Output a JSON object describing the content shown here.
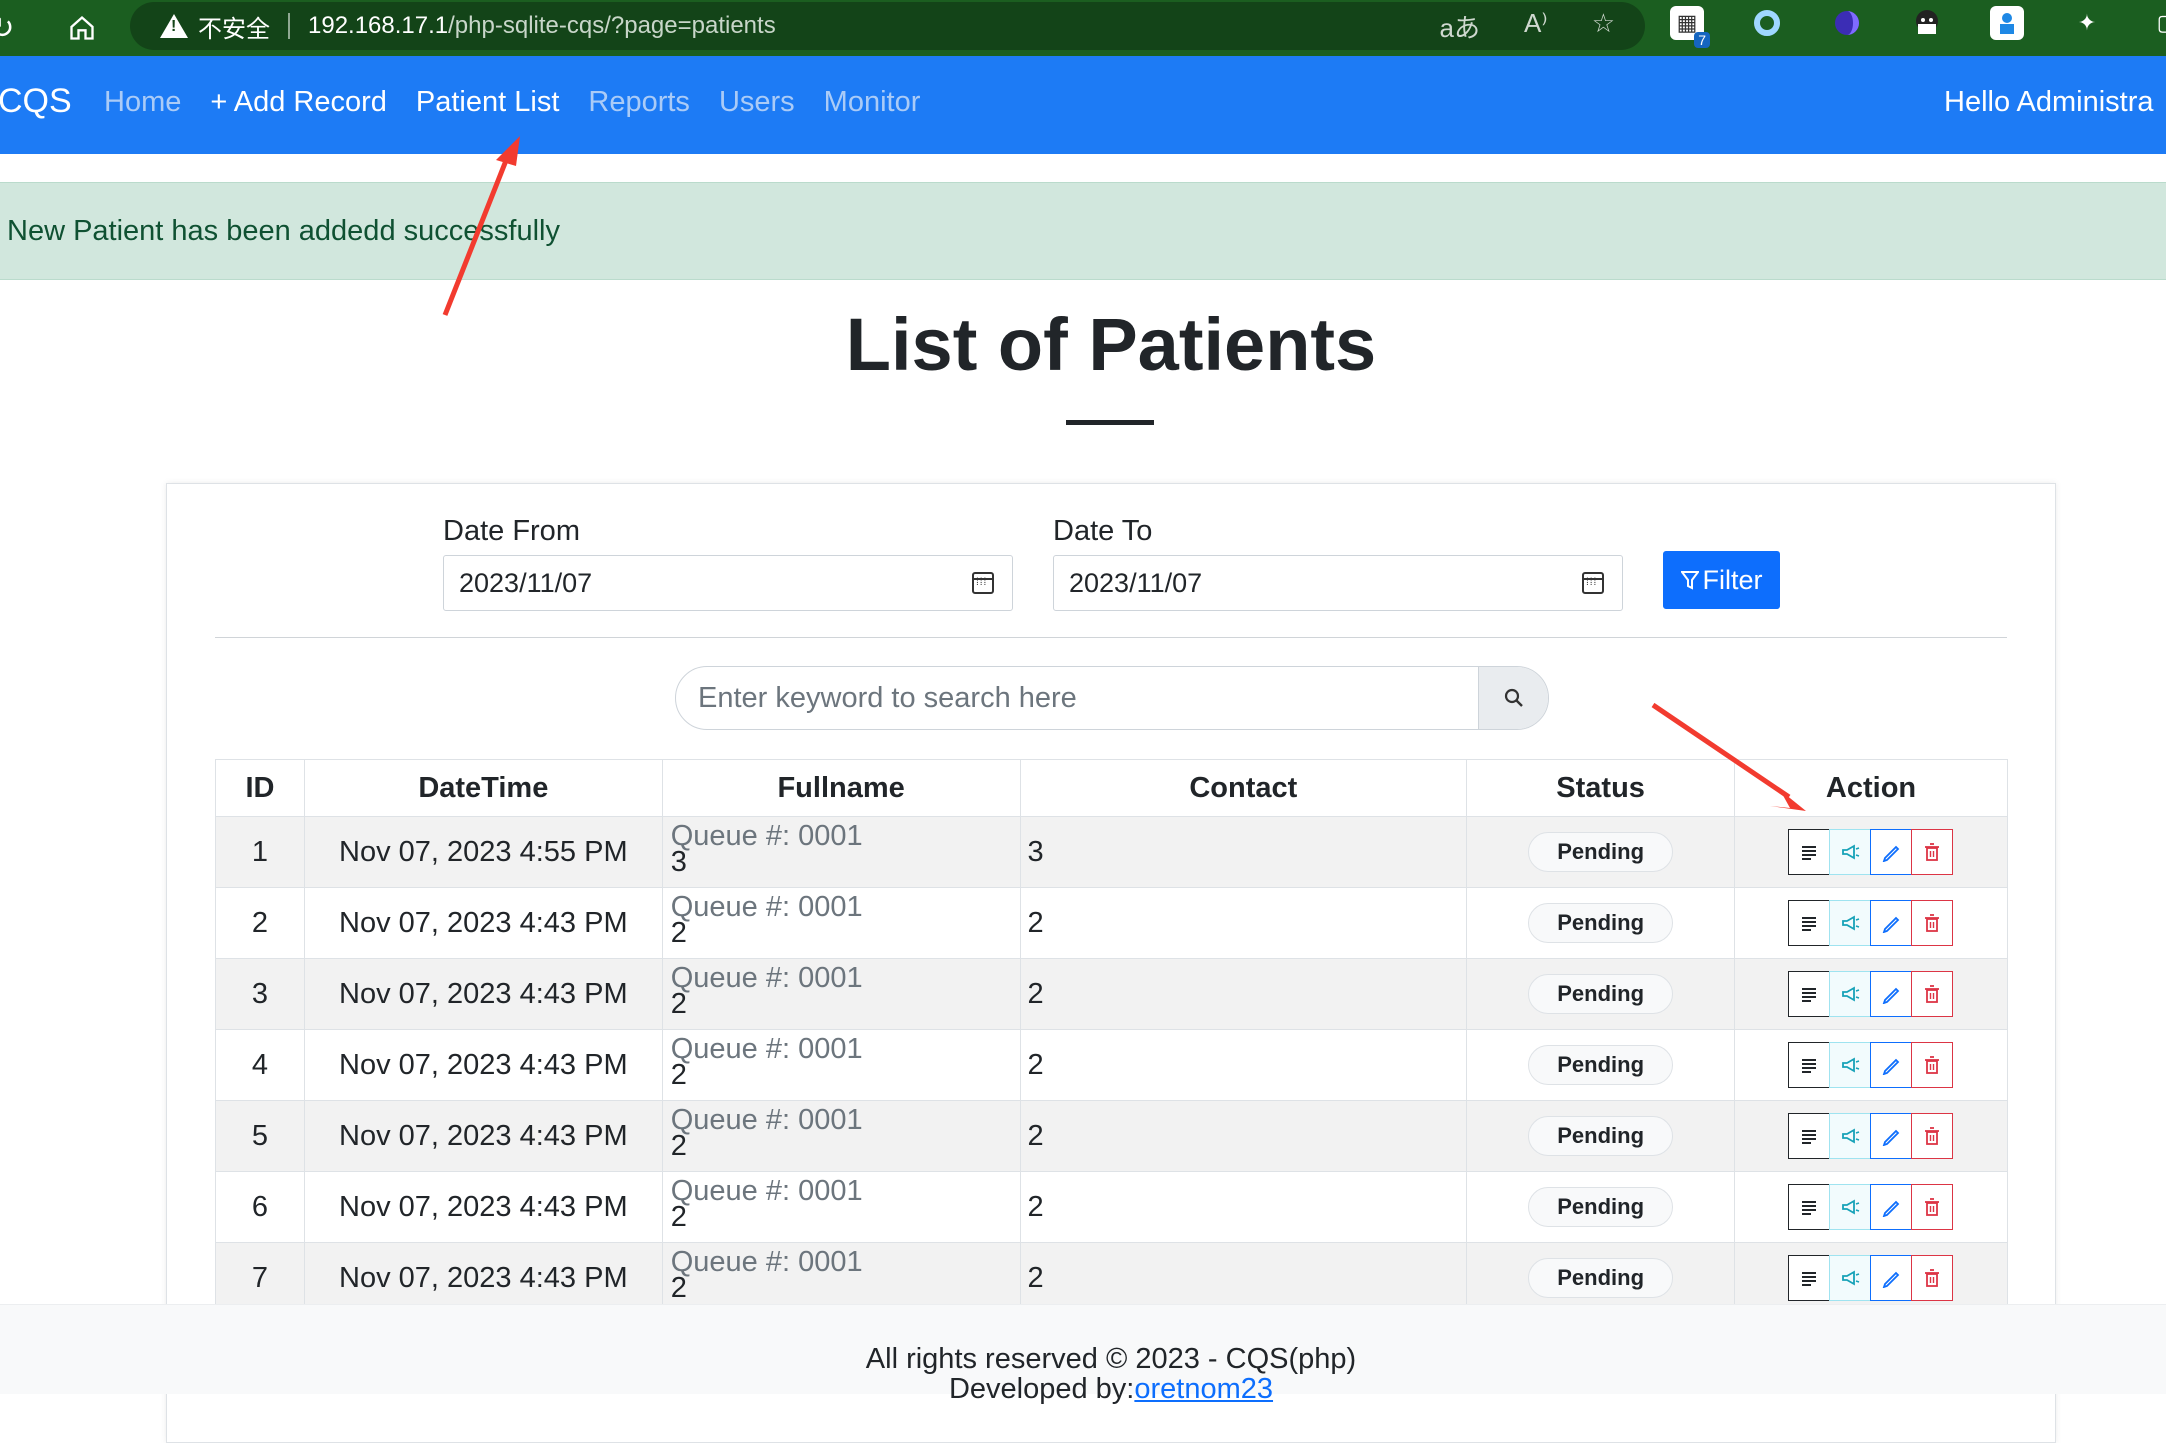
{
  "browser": {
    "security_text": "不安全",
    "url_host": "192.168.17.1",
    "url_path": "/php-sqlite-cqs/?page=patients",
    "extension_badge": "7",
    "colors": {
      "chrome": "#1b5e20",
      "address_bar": "#134418"
    }
  },
  "navbar": {
    "brand": "CQS",
    "links": [
      {
        "label": "Home",
        "active": false
      },
      {
        "label": "+ Add Record",
        "active": true
      },
      {
        "label": "Patient List",
        "active": true
      },
      {
        "label": "Reports",
        "active": false
      },
      {
        "label": "Users",
        "active": false
      },
      {
        "label": "Monitor",
        "active": false
      }
    ],
    "greeting": "Hello Administra",
    "color": "#1d7bf5"
  },
  "alert": {
    "message": "New Patient has been addedd successfully",
    "color": "#d1e7dd"
  },
  "page": {
    "title": "List of Patients"
  },
  "filter": {
    "date_from_label": "Date From",
    "date_from_value": "2023/11/07",
    "date_to_label": "Date To",
    "date_to_value": "2023/11/07",
    "button_label": "Filter"
  },
  "search": {
    "placeholder": "Enter keyword to search here"
  },
  "table": {
    "headers": [
      "ID",
      "DateTime",
      "Fullname",
      "Contact",
      "Status",
      "Action"
    ],
    "rows": [
      {
        "id": "1",
        "datetime": "Nov 07, 2023 4:55 PM",
        "queue": "Queue #: 0001",
        "name": "3",
        "contact": "3",
        "status": "Pending"
      },
      {
        "id": "2",
        "datetime": "Nov 07, 2023 4:43 PM",
        "queue": "Queue #: 0001",
        "name": "2",
        "contact": "2",
        "status": "Pending"
      },
      {
        "id": "3",
        "datetime": "Nov 07, 2023 4:43 PM",
        "queue": "Queue #: 0001",
        "name": "2",
        "contact": "2",
        "status": "Pending"
      },
      {
        "id": "4",
        "datetime": "Nov 07, 2023 4:43 PM",
        "queue": "Queue #: 0001",
        "name": "2",
        "contact": "2",
        "status": "Pending"
      },
      {
        "id": "5",
        "datetime": "Nov 07, 2023 4:43 PM",
        "queue": "Queue #: 0001",
        "name": "2",
        "contact": "2",
        "status": "Pending"
      },
      {
        "id": "6",
        "datetime": "Nov 07, 2023 4:43 PM",
        "queue": "Queue #: 0001",
        "name": "2",
        "contact": "2",
        "status": "Pending"
      },
      {
        "id": "7",
        "datetime": "Nov 07, 2023 4:43 PM",
        "queue": "Queue #: 0001",
        "name": "2",
        "contact": "2",
        "status": "Pending"
      }
    ],
    "action_icons": [
      "list-icon",
      "megaphone-icon",
      "pencil-icon",
      "trash-icon"
    ]
  },
  "footer": {
    "line1": "All rights reserved © 2023 - CQS(php)",
    "line2_prefix": "Developed by:",
    "line2_link": "oretnom23"
  },
  "annotation_color": "#f23b2f"
}
